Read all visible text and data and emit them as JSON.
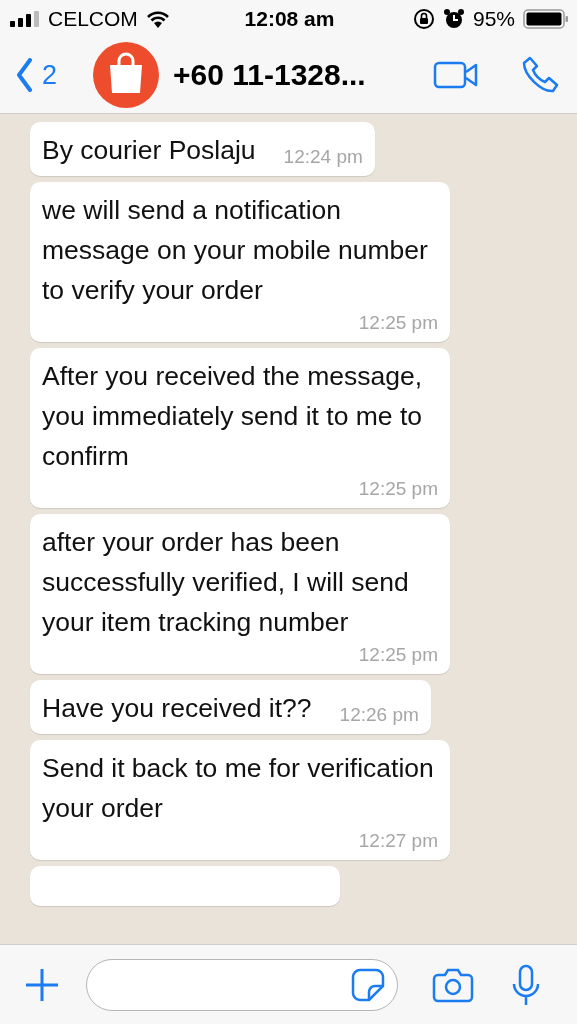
{
  "status_bar": {
    "carrier": "CELCOM",
    "time": "12:08 am",
    "battery": "95%"
  },
  "header": {
    "back_count": "2",
    "title": "+60 11-1328..."
  },
  "messages": [
    {
      "text": "By courier Poslaju",
      "time": "12:24 pm"
    },
    {
      "text": "we will send a notification message on your mobile number to verify your order",
      "time": "12:25 pm"
    },
    {
      "text": "After you received the message, you immediately send it to me to confirm",
      "time": "12:25 pm"
    },
    {
      "text": "after your order has been successfully verified, I will send your item tracking number",
      "time": "12:25 pm"
    },
    {
      "text": "Have you received it??",
      "time": "12:26 pm"
    },
    {
      "text": "Send it back to me for verification your order",
      "time": "12:27 pm"
    }
  ]
}
